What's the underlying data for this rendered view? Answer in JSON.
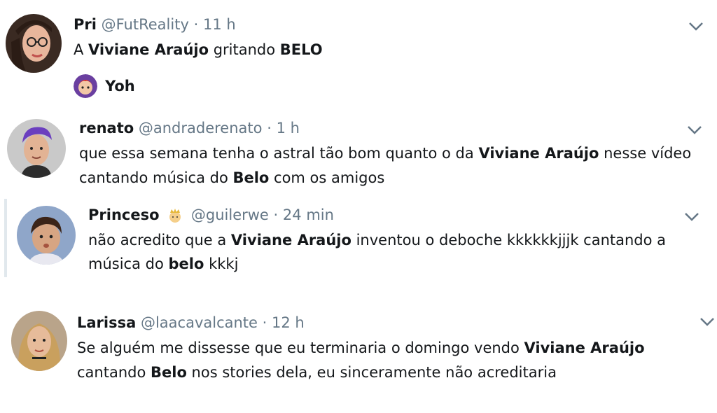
{
  "colors": {
    "text": "#14171a",
    "secondary": "#657786",
    "border": "#e1e8ed"
  },
  "tweets": [
    {
      "name": "Pri",
      "handle": "@FutReality",
      "dot": "·",
      "time": "11 h",
      "body": [
        "A ",
        "Viviane Araújo",
        " gritando ",
        "BELO"
      ],
      "reply_name": "Yoh",
      "avatar_icon": "avatar-woman-glasses-icon"
    },
    {
      "name": "renato",
      "handle": "@andraderenato",
      "dot": "·",
      "time": "1 h",
      "line1": [
        "que essa semana tenha o astral tão bom quanto o da ",
        "Viviane Araújo",
        " nesse vídeo"
      ],
      "line2": [
        "cantando música do ",
        "Belo",
        " com os amigos"
      ],
      "avatar_icon": "avatar-man-purple-hair-icon"
    },
    {
      "name": "Princeso",
      "handle": "@guilerwe",
      "dot": "·",
      "time": "24 min",
      "line1": [
        "não acredito que a ",
        "Viviane Araújo",
        " inventou o deboche kkkkkkjjjk cantando a"
      ],
      "line2": [
        "música do ",
        "belo",
        " kkkj"
      ],
      "avatar_icon": "avatar-child-icon",
      "badge_icon": "prince-emoji-icon"
    },
    {
      "name": "Larissa",
      "handle": "@laacavalcante",
      "dot": "·",
      "time": "12 h",
      "line1": [
        "Se alguém me dissesse que eu terminaria o domingo vendo ",
        "Viviane Araújo"
      ],
      "line2": [
        "cantando ",
        "Belo",
        " nos stories dela, eu sinceramente não acreditaria"
      ],
      "avatar_icon": "avatar-woman-blonde-icon"
    }
  ]
}
